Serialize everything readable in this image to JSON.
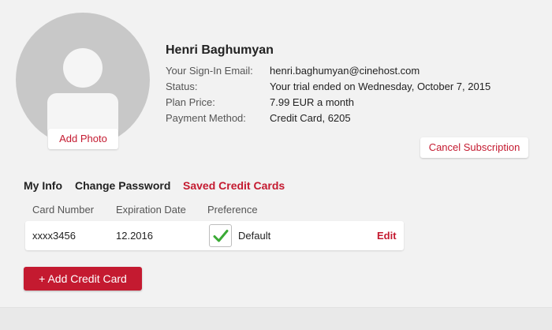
{
  "profile": {
    "name": "Henri Baghumyan",
    "add_photo_label": "Add Photo"
  },
  "account_info": [
    {
      "label": "Your Sign-In Email:",
      "value": "henri.baghumyan@cinehost.com"
    },
    {
      "label": "Status:",
      "value": "Your trial ended on Wednesday, October 7, 2015"
    },
    {
      "label": "Plan Price:",
      "value": "7.99 EUR a month"
    },
    {
      "label": "Payment Method:",
      "value": "Credit Card, 6205"
    }
  ],
  "cancel_subscription_label": "Cancel Subscription",
  "tabs": [
    {
      "label": "My Info",
      "active": false
    },
    {
      "label": "Change Password",
      "active": false
    },
    {
      "label": "Saved Credit Cards",
      "active": true
    }
  ],
  "cards_table": {
    "columns": [
      "Card Number",
      "Expiration Date",
      "Preference"
    ],
    "rows": [
      {
        "card_number": "xxxx3456",
        "expiration": "12.2016",
        "preference": "Default",
        "checked": true,
        "edit_label": "Edit"
      }
    ]
  },
  "add_card_label": "+ Add Credit Card",
  "colors": {
    "accent": "#c41a30",
    "check": "#3aaa35",
    "background": "#f2f2f2"
  },
  "icons": {
    "avatar": "user-placeholder-icon",
    "check": "check-icon"
  }
}
